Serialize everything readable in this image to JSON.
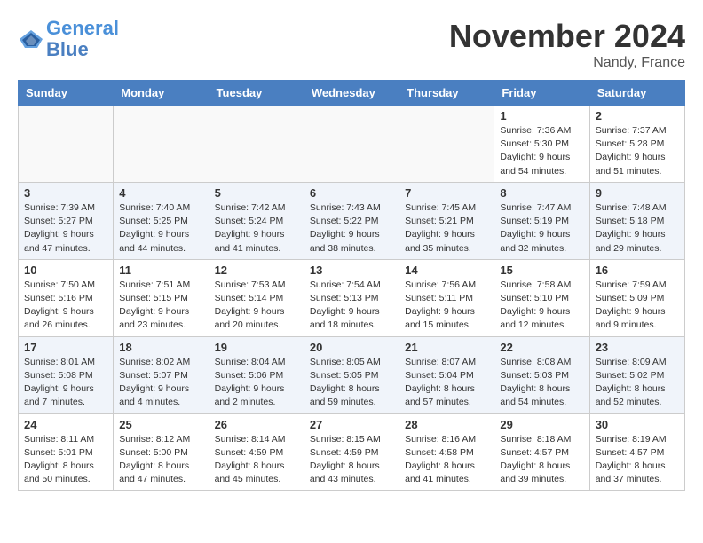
{
  "header": {
    "logo_line1": "General",
    "logo_line2": "Blue",
    "title": "November 2024",
    "subtitle": "Nandy, France"
  },
  "days_of_week": [
    "Sunday",
    "Monday",
    "Tuesday",
    "Wednesday",
    "Thursday",
    "Friday",
    "Saturday"
  ],
  "weeks": [
    [
      {
        "day": "",
        "info": ""
      },
      {
        "day": "",
        "info": ""
      },
      {
        "day": "",
        "info": ""
      },
      {
        "day": "",
        "info": ""
      },
      {
        "day": "",
        "info": ""
      },
      {
        "day": "1",
        "info": "Sunrise: 7:36 AM\nSunset: 5:30 PM\nDaylight: 9 hours\nand 54 minutes."
      },
      {
        "day": "2",
        "info": "Sunrise: 7:37 AM\nSunset: 5:28 PM\nDaylight: 9 hours\nand 51 minutes."
      }
    ],
    [
      {
        "day": "3",
        "info": "Sunrise: 7:39 AM\nSunset: 5:27 PM\nDaylight: 9 hours\nand 47 minutes."
      },
      {
        "day": "4",
        "info": "Sunrise: 7:40 AM\nSunset: 5:25 PM\nDaylight: 9 hours\nand 44 minutes."
      },
      {
        "day": "5",
        "info": "Sunrise: 7:42 AM\nSunset: 5:24 PM\nDaylight: 9 hours\nand 41 minutes."
      },
      {
        "day": "6",
        "info": "Sunrise: 7:43 AM\nSunset: 5:22 PM\nDaylight: 9 hours\nand 38 minutes."
      },
      {
        "day": "7",
        "info": "Sunrise: 7:45 AM\nSunset: 5:21 PM\nDaylight: 9 hours\nand 35 minutes."
      },
      {
        "day": "8",
        "info": "Sunrise: 7:47 AM\nSunset: 5:19 PM\nDaylight: 9 hours\nand 32 minutes."
      },
      {
        "day": "9",
        "info": "Sunrise: 7:48 AM\nSunset: 5:18 PM\nDaylight: 9 hours\nand 29 minutes."
      }
    ],
    [
      {
        "day": "10",
        "info": "Sunrise: 7:50 AM\nSunset: 5:16 PM\nDaylight: 9 hours\nand 26 minutes."
      },
      {
        "day": "11",
        "info": "Sunrise: 7:51 AM\nSunset: 5:15 PM\nDaylight: 9 hours\nand 23 minutes."
      },
      {
        "day": "12",
        "info": "Sunrise: 7:53 AM\nSunset: 5:14 PM\nDaylight: 9 hours\nand 20 minutes."
      },
      {
        "day": "13",
        "info": "Sunrise: 7:54 AM\nSunset: 5:13 PM\nDaylight: 9 hours\nand 18 minutes."
      },
      {
        "day": "14",
        "info": "Sunrise: 7:56 AM\nSunset: 5:11 PM\nDaylight: 9 hours\nand 15 minutes."
      },
      {
        "day": "15",
        "info": "Sunrise: 7:58 AM\nSunset: 5:10 PM\nDaylight: 9 hours\nand 12 minutes."
      },
      {
        "day": "16",
        "info": "Sunrise: 7:59 AM\nSunset: 5:09 PM\nDaylight: 9 hours\nand 9 minutes."
      }
    ],
    [
      {
        "day": "17",
        "info": "Sunrise: 8:01 AM\nSunset: 5:08 PM\nDaylight: 9 hours\nand 7 minutes."
      },
      {
        "day": "18",
        "info": "Sunrise: 8:02 AM\nSunset: 5:07 PM\nDaylight: 9 hours\nand 4 minutes."
      },
      {
        "day": "19",
        "info": "Sunrise: 8:04 AM\nSunset: 5:06 PM\nDaylight: 9 hours\nand 2 minutes."
      },
      {
        "day": "20",
        "info": "Sunrise: 8:05 AM\nSunset: 5:05 PM\nDaylight: 8 hours\nand 59 minutes."
      },
      {
        "day": "21",
        "info": "Sunrise: 8:07 AM\nSunset: 5:04 PM\nDaylight: 8 hours\nand 57 minutes."
      },
      {
        "day": "22",
        "info": "Sunrise: 8:08 AM\nSunset: 5:03 PM\nDaylight: 8 hours\nand 54 minutes."
      },
      {
        "day": "23",
        "info": "Sunrise: 8:09 AM\nSunset: 5:02 PM\nDaylight: 8 hours\nand 52 minutes."
      }
    ],
    [
      {
        "day": "24",
        "info": "Sunrise: 8:11 AM\nSunset: 5:01 PM\nDaylight: 8 hours\nand 50 minutes."
      },
      {
        "day": "25",
        "info": "Sunrise: 8:12 AM\nSunset: 5:00 PM\nDaylight: 8 hours\nand 47 minutes."
      },
      {
        "day": "26",
        "info": "Sunrise: 8:14 AM\nSunset: 4:59 PM\nDaylight: 8 hours\nand 45 minutes."
      },
      {
        "day": "27",
        "info": "Sunrise: 8:15 AM\nSunset: 4:59 PM\nDaylight: 8 hours\nand 43 minutes."
      },
      {
        "day": "28",
        "info": "Sunrise: 8:16 AM\nSunset: 4:58 PM\nDaylight: 8 hours\nand 41 minutes."
      },
      {
        "day": "29",
        "info": "Sunrise: 8:18 AM\nSunset: 4:57 PM\nDaylight: 8 hours\nand 39 minutes."
      },
      {
        "day": "30",
        "info": "Sunrise: 8:19 AM\nSunset: 4:57 PM\nDaylight: 8 hours\nand 37 minutes."
      }
    ]
  ]
}
